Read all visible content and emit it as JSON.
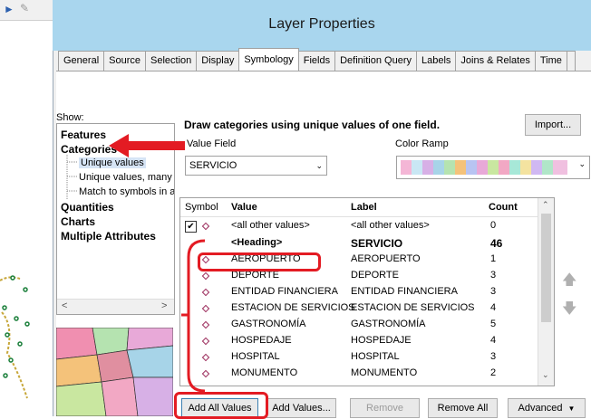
{
  "dialog": {
    "title": "Layer Properties"
  },
  "tabs": [
    "General",
    "Source",
    "Selection",
    "Display",
    "Symbology",
    "Fields",
    "Definition Query",
    "Labels",
    "Joins & Relates",
    "Time"
  ],
  "show": {
    "label": "Show:",
    "items": [
      {
        "label": "Features",
        "level": 0
      },
      {
        "label": "Categories",
        "level": 0
      },
      {
        "label": "Unique values",
        "level": 1
      },
      {
        "label": "Unique values, many",
        "level": 1
      },
      {
        "label": "Match to symbols in a",
        "level": 1
      },
      {
        "label": "Quantities",
        "level": 0
      },
      {
        "label": "Charts",
        "level": 0
      },
      {
        "label": "Multiple Attributes",
        "level": 0
      }
    ]
  },
  "symbology": {
    "heading": "Draw categories using unique values of one field.",
    "import_label": "Import...",
    "value_field_label": "Value Field",
    "value_field_value": "SERVICIO",
    "color_ramp_label": "Color Ramp"
  },
  "table": {
    "headers": {
      "symbol": "Symbol",
      "value": "Value",
      "label": "Label",
      "count": "Count"
    },
    "rows": [
      {
        "value": "<all other values>",
        "label": "<all other values>",
        "count": "0",
        "bold": false
      },
      {
        "value": "<Heading>",
        "label": "SERVICIO",
        "count": "46",
        "bold": true
      },
      {
        "value": "AEROPUERTO",
        "label": "AEROPUERTO",
        "count": "1",
        "bold": false
      },
      {
        "value": "DEPORTE",
        "label": "DEPORTE",
        "count": "3",
        "bold": false
      },
      {
        "value": "ENTIDAD FINANCIERA",
        "label": "ENTIDAD FINANCIERA",
        "count": "3",
        "bold": false
      },
      {
        "value": "ESTACION DE SERVICIOS",
        "label": "ESTACION DE SERVICIOS",
        "count": "4",
        "bold": false
      },
      {
        "value": "GASTRONOMÍA",
        "label": "GASTRONOMÍA",
        "count": "5",
        "bold": false
      },
      {
        "value": "HOSPEDAJE",
        "label": "HOSPEDAJE",
        "count": "4",
        "bold": false
      },
      {
        "value": "HOSPITAL",
        "label": "HOSPITAL",
        "count": "3",
        "bold": false
      },
      {
        "value": "MONUMENTO",
        "label": "MONUMENTO",
        "count": "2",
        "bold": false
      }
    ]
  },
  "buttons": {
    "add_all": "Add All Values",
    "add": "Add Values...",
    "remove": "Remove",
    "remove_all": "Remove All",
    "advanced": "Advanced"
  },
  "colors": {
    "title_bar": "#a9d6ee",
    "highlight": "#e31b23",
    "symbol": "#9b2a5a"
  }
}
